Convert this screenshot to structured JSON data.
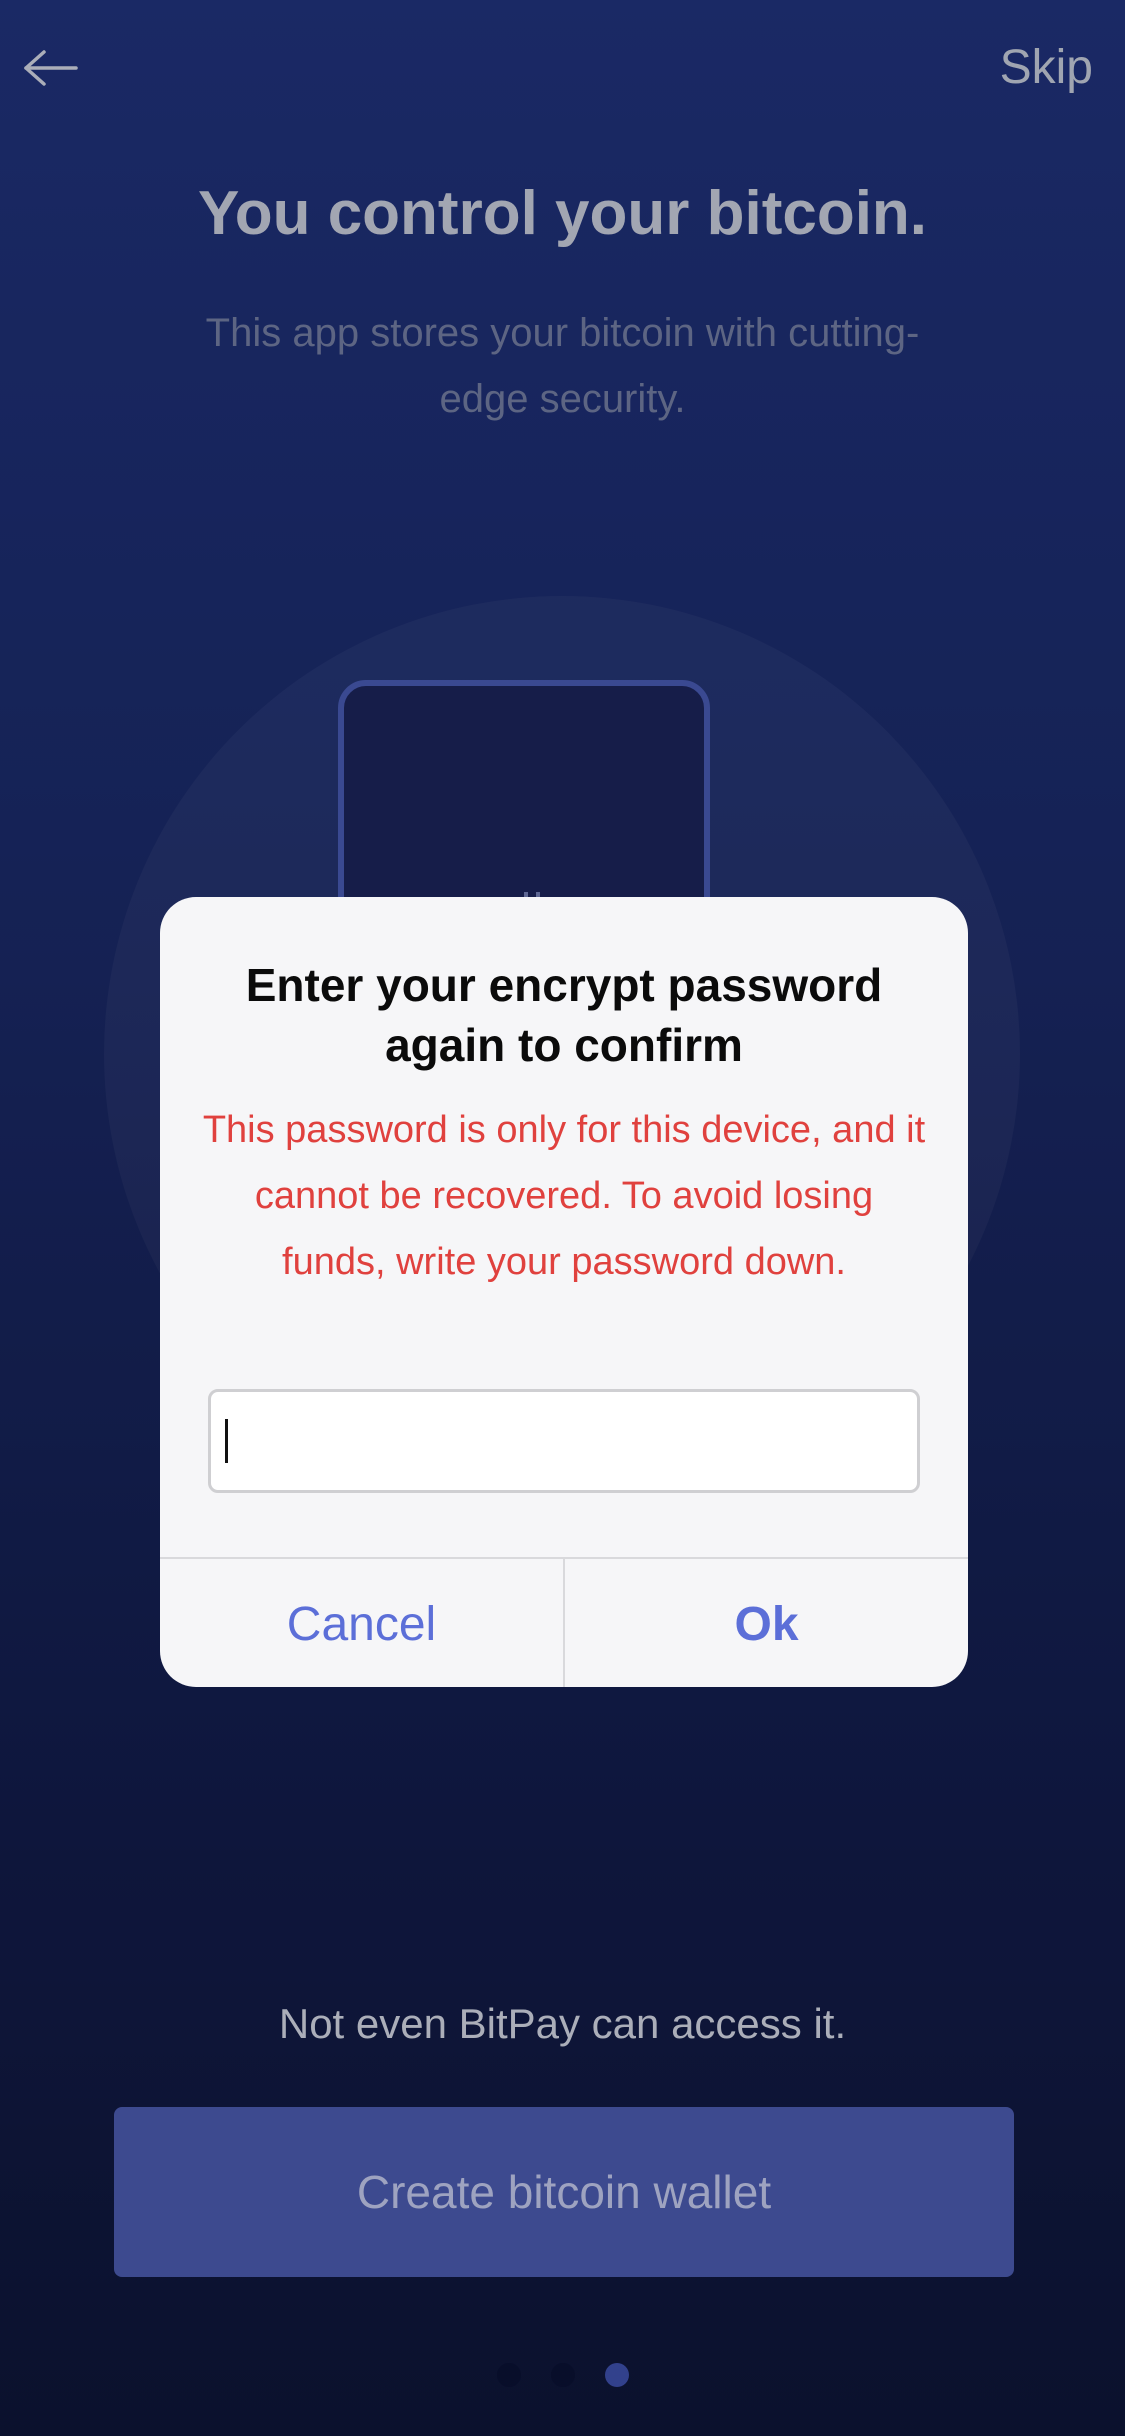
{
  "header": {
    "skip_label": "Skip",
    "back_icon": "arrow-left-icon"
  },
  "intro": {
    "title": "You control your bitcoin.",
    "subtitle": "This app stores your bitcoin with cutting-edge security."
  },
  "dialog": {
    "title": "Enter your encrypt password again to confirm",
    "message": "This password is only for this device, and it cannot be recovered. To avoid losing funds, write your password down.",
    "input_value": "",
    "cancel_label": "Cancel",
    "ok_label": "Ok",
    "message_color": "#e0413e",
    "button_color": "#5c6fd8"
  },
  "footer": {
    "caption": "Not even BitPay can access it.",
    "create_button_label": "Create bitcoin wallet"
  },
  "pager": {
    "pages": 3,
    "active_index": 2
  },
  "colors": {
    "background_top": "#1e2f73",
    "background_bottom": "#0d1434",
    "primary_button": "#4655a3"
  }
}
